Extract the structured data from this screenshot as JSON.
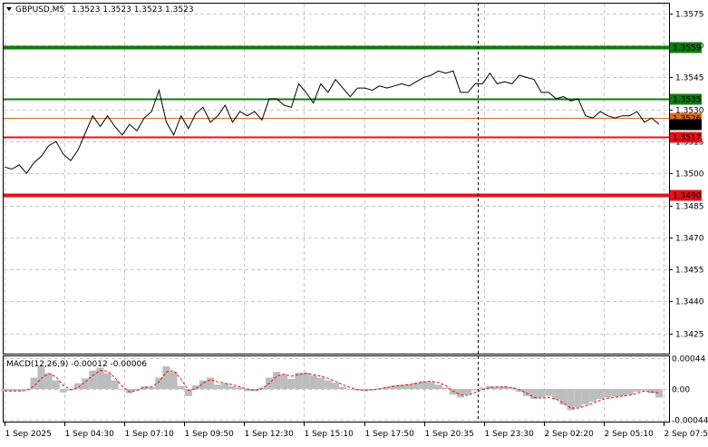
{
  "header": {
    "symbol": "GBPUSD,M5",
    "ohlc": "1.3523 1.3523 1.3523 1.3523"
  },
  "macd": {
    "title": "MACD(12,26,9) -0.00012 -0.00006",
    "y_ticks": [
      "0.00044",
      "0.00",
      "-0.00044"
    ]
  },
  "colors": {
    "price_line": "#000000",
    "level_green": "#0f7a0f",
    "level_red": "#e8101a",
    "current_line": "#e06a1a",
    "histogram": "#bdbdbd",
    "signal": "#e81010"
  },
  "chart_data": [
    {
      "type": "line",
      "title": "GBPUSD,M5",
      "ylim": [
        1.34155,
        1.35796
      ],
      "y_ticks": [
        "1.3575",
        "1.3560",
        "1.3545",
        "1.3530",
        "1.3515",
        "1.3500",
        "1.3485",
        "1.3470",
        "1.3455",
        "1.3440",
        "1.3425"
      ],
      "x_ticks": [
        "1 Sep 2025",
        "1 Sep 04:30",
        "1 Sep 07:10",
        "1 Sep 09:50",
        "1 Sep 12:30",
        "1 Sep 15:10",
        "1 Sep 17:50",
        "1 Sep 20:35",
        "1 Sep 23:30",
        "2 Sep 02:20",
        "2 Sep 05:10",
        "2 Sep 07:50"
      ],
      "levels": [
        {
          "value": 1.3559,
          "label": "1.3559",
          "color": "#0f7a0f"
        },
        {
          "value": 1.3535,
          "label": "1.3535",
          "color": "#0f7a0f"
        },
        {
          "value": 1.3526,
          "label": "1.3526",
          "color": "#e06a1a"
        },
        {
          "value": 1.3517,
          "label": "1.3517",
          "color": "#e8101a"
        },
        {
          "value": 1.349,
          "label": "1.3490",
          "color": "#e8101a"
        }
      ],
      "current": {
        "value": 1.3523,
        "label": "1.3523"
      },
      "series": [
        {
          "values": [
            1.3503,
            1.3502,
            1.3504,
            1.35,
            1.3505,
            1.3508,
            1.3513,
            1.3515,
            1.3509,
            1.3506,
            1.3511,
            1.3519,
            1.3527,
            1.3522,
            1.3527,
            1.3522,
            1.3518,
            1.3523,
            1.352,
            1.3526,
            1.3529,
            1.3539,
            1.3524,
            1.3518,
            1.3527,
            1.3521,
            1.3528,
            1.3531,
            1.3524,
            1.3527,
            1.3532,
            1.3524,
            1.3529,
            1.3527,
            1.3529,
            1.3525,
            1.3535,
            1.3535,
            1.3532,
            1.3531,
            1.3542,
            1.3538,
            1.3533,
            1.3542,
            1.3538,
            1.3544,
            1.354,
            1.3536,
            1.354,
            1.354,
            1.3539,
            1.3541,
            1.354,
            1.3541,
            1.3542,
            1.3541,
            1.3543,
            1.3545,
            1.3546,
            1.3548,
            1.3547,
            1.3548,
            1.3538,
            1.3538,
            1.3542,
            1.3542,
            1.3547,
            1.3542,
            1.3543,
            1.3542,
            1.3546,
            1.3545,
            1.3544,
            1.3538,
            1.3538,
            1.3535,
            1.3536,
            1.3534,
            1.3535,
            1.3527,
            1.3526,
            1.3529,
            1.3527,
            1.3526,
            1.3527,
            1.3527,
            1.3529,
            1.3524,
            1.3526,
            1.3523
          ]
        }
      ]
    },
    {
      "type": "bar",
      "title": "MACD(12,26,9) -0.00012 -0.00006",
      "ylim": [
        -0.00046,
        0.00046
      ],
      "y_ticks": [
        "0.00044",
        "0.00",
        "-0.00044"
      ],
      "series": [
        {
          "name": "MACD",
          "values": [
            -3e-05,
            -3e-05,
            -3e-05,
            -1e-05,
            0.00016,
            0.00032,
            0.00022,
            0.00012,
            -5e-05,
            -2e-05,
            8e-05,
            0.00015,
            0.00026,
            0.0003,
            0.00022,
            0.00012,
            0.0,
            -6e-05,
            -2e-05,
            4e-05,
            3e-05,
            0.00016,
            0.00032,
            0.00024,
            4e-05,
            -0.0001,
            5e-05,
            0.00012,
            0.00016,
            6e-05,
            8e-05,
            4e-05,
            2e-05,
            -3e-05,
            -3e-05,
            2e-05,
            0.00016,
            0.00024,
            0.0002,
            0.00014,
            0.00023,
            0.00023,
            0.00019,
            0.00016,
            0.00012,
            9e-05,
            3e-05,
            -1e-05,
            -2e-05,
            -2e-05,
            -2e-05,
            1e-05,
            3e-05,
            5e-05,
            6e-05,
            7e-05,
            9e-05,
            0.00011,
            0.0001,
            6e-05,
            2e-05,
            -8e-05,
            -0.00012,
            -8e-05,
            -2e-05,
            2e-05,
            4e-05,
            3e-05,
            4e-05,
            2e-05,
            -4e-05,
            -0.0001,
            -0.00014,
            -0.00012,
            -0.0001,
            -0.00015,
            -0.00022,
            -0.0003,
            -0.00026,
            -0.00022,
            -0.00018,
            -0.00014,
            -0.00012,
            -0.00011,
            -0.0001,
            -8e-05,
            -4e-05,
            -2e-05,
            -6e-05,
            -0.00012
          ]
        },
        {
          "name": "Signal",
          "values": [
            -3e-05,
            -3e-05,
            -3e-05,
            -2e-05,
            4e-05,
            0.00015,
            0.00022,
            0.00017,
            5e-05,
            -1e-05,
            2e-05,
            0.0001,
            0.00019,
            0.00026,
            0.00025,
            0.00016,
            4e-05,
            -4e-05,
            -2e-05,
            2e-05,
            3e-05,
            0.0001,
            0.00024,
            0.00026,
            0.00014,
            -2e-05,
            0.0,
            8e-05,
            0.00013,
            0.0001,
            8e-05,
            6e-05,
            3e-05,
            0.0,
            -2e-05,
            0.0,
            8e-05,
            0.00018,
            0.00021,
            0.00018,
            0.0002,
            0.00022,
            0.0002,
            0.00018,
            0.00015,
            0.00011,
            6e-05,
            2e-05,
            -1e-05,
            -2e-05,
            -1e-05,
            0.0,
            2e-05,
            4e-05,
            5e-05,
            6e-05,
            8e-05,
            0.0001,
            0.00011,
            9e-05,
            5e-05,
            -3e-05,
            -8e-05,
            -9e-05,
            -5e-05,
            -1e-05,
            2e-05,
            3e-05,
            3e-05,
            2e-05,
            -1e-05,
            -6e-05,
            -0.00012,
            -0.00013,
            -0.00012,
            -0.00014,
            -0.0002,
            -0.00027,
            -0.00027,
            -0.00024,
            -0.0002,
            -0.00016,
            -0.00013,
            -0.00012,
            -0.0001,
            -9e-05,
            -6e-05,
            -3e-05,
            -4e-05,
            -6e-05
          ]
        }
      ]
    }
  ]
}
